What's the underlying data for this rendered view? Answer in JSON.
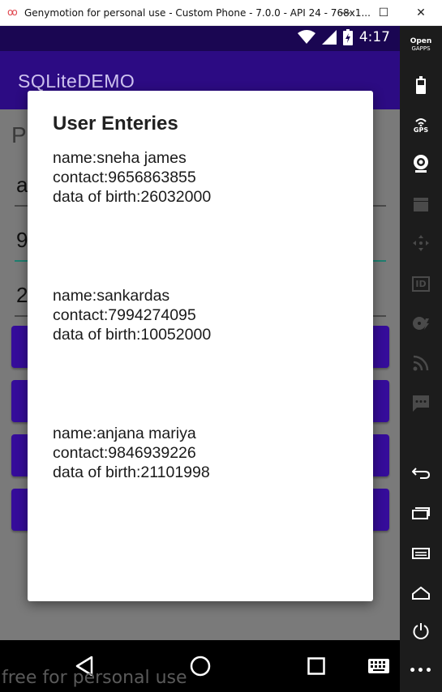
{
  "window": {
    "title": "Genymotion for personal use - Custom Phone - 7.0.0 - API 24 - 768x1...",
    "app_icon": "genymotion-logo-icon",
    "minimize": "—",
    "maximize": "☐",
    "close": "✕"
  },
  "statusbar": {
    "time": "4:17"
  },
  "app": {
    "title": "SQLiteDEMO",
    "heading_partial": "P",
    "fields": [
      "a",
      "9",
      "2"
    ],
    "button_count": 4
  },
  "dialog": {
    "title": "User Enteries",
    "entries": [
      {
        "name": "name:sneha james",
        "contact": "contact:9656863855",
        "dob": "data of birth:26032000"
      },
      {
        "name": "name:sankardas",
        "contact": "contact:7994274095",
        "dob": "data of birth:10052000"
      },
      {
        "name": "name:anjana mariya",
        "contact": "contact:9846939226",
        "dob": "data of birth:21101998"
      }
    ]
  },
  "watermark": "free for personal use",
  "sidebar": {
    "opengapps_line1": "Open",
    "opengapps_line2": "GAPPS",
    "gps_label": "GPS",
    "id_label": "ID",
    "more_label": "•••"
  },
  "colors": {
    "status_bar": "#1a0652",
    "app_bar": "#2c0b83",
    "button": "#350c9a",
    "scrim": "#7a7a7a",
    "sidebar": "#1c1c1c"
  }
}
